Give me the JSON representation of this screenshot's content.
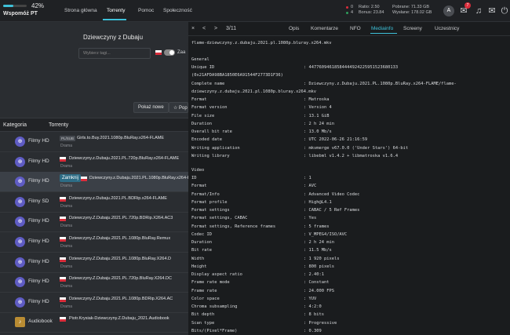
{
  "topbar": {
    "progress_fraction": 0.42,
    "progress_pct": "42%",
    "support_label": "Wspomóż PT",
    "nav": [
      "Strona główna",
      "Torrenty",
      "Pomoc",
      "Społeczność"
    ],
    "active_nav": "Torrenty",
    "stats": {
      "seeding_count": "0",
      "leeching_count": "4",
      "ratio": "Ratio: 2.50",
      "bonus": "Bonus: 23.84",
      "downloaded": "Pobrane: 71.33 GB",
      "uploaded": "Wysłane: 178.02 GB"
    },
    "avatar_letter": "A",
    "notification_badge": "7",
    "accent_color": "#3ec0d8"
  },
  "search": {
    "query": "Dziewczyny z Dubaju",
    "tags_placeholder": "Wybierz tagi...",
    "toggle_label": "Zaa"
  },
  "buttons": {
    "new": "Pokaż nowe",
    "popular": "☆ Popularne"
  },
  "table": {
    "headers": [
      "Kategoria",
      "Torrenty"
    ],
    "rows": [
      {
        "category": "Filmy HD",
        "tag": "PL/SUB",
        "name": "Girls.to.Buy.2021.1080p.BluRay.x264-FLAME",
        "genre": "Drama"
      },
      {
        "category": "Filmy HD",
        "name": "Dziewczyny.z.Dubaju.2021.PL.720p.BluRay.x264-FLAME",
        "genre": "Drama"
      },
      {
        "category": "Filmy HD",
        "close_label": "Zamknij",
        "name": "Dziewczyny.z.Dubaju.2021.PL.1080p.BluRay.x264-FLAME",
        "genre": "Drama"
      },
      {
        "category": "Filmy SD",
        "name": "Dziewczyny.z.Dubaju.2021.PL.BDRip.x264-FLAME",
        "genre": "Drama"
      },
      {
        "category": "Filmy HD",
        "name": "Dziewczyny.Z.Dubaju.2021.PL.720p.BDRip.X264.AC3",
        "genre": "Drama"
      },
      {
        "category": "Filmy HD",
        "name": "Dziewczyny.Z.Dubaju.2021.PL.1080p.BluRay.Remux",
        "genre": "Drama"
      },
      {
        "category": "Filmy HD",
        "name": "Dziewczyny.Z.Dubaju.2021.PL.1080p.BluRay.X264.D",
        "genre": "Drama"
      },
      {
        "category": "Filmy HD",
        "name": "Dziewczyny.Z.Dubaju.2021.PL.720p.BluRay.X264.DC",
        "genre": "Drama"
      },
      {
        "category": "Filmy HD",
        "name": "Dziewczyny.Z.Dubaju.2021.PL.1080p.BDRip.X264.AC",
        "genre": "Drama"
      },
      {
        "category": "Audiobook",
        "name": "Piotr.Krysiak-Dziewczyny.Z.Dubaju_2021.Audiobook",
        "genre": ""
      }
    ]
  },
  "panel": {
    "nav": {
      "close": "×",
      "prev": "<",
      "next": ">",
      "pager": "3/11"
    },
    "tabs": [
      "Opis",
      "Komentarze",
      "NFO",
      "Mediainfo",
      "Screeny",
      "Uczestnicy"
    ],
    "active_tab": "Mediainfo",
    "filename": "flame-dziewczyny.z.dubaju.2021.pl.1080p.bluray.x264.mkv",
    "general_title": "General",
    "general": [
      [
        "Unique ID",
        ": 44776094618584444924225951523680133"
      ],
      [
        "(0x21AFDA98BA1850E6A91544F2773D1F36)",
        ""
      ],
      [
        "Complete name",
        ": Dziewczyny.z.Dubaju.2021.PL.1080p.BluRay.x264-FLAME/flame-"
      ],
      [
        "dziewczyny.z.dubaju.2021.pl.1080p.bluray.x264.mkv",
        ""
      ],
      [
        "Format",
        ": Matroska"
      ],
      [
        "Format version",
        ": Version 4"
      ],
      [
        "File size",
        ": 13.1 GiB"
      ],
      [
        "Duration",
        ": 2 h 24 min"
      ],
      [
        "Overall bit rate",
        ": 13.0 Mb/s"
      ],
      [
        "Encoded date",
        ": UTC 2022-06-26 21:16:59"
      ],
      [
        "Writing application",
        ": mkvmerge v67.0.0 ('Under Stars') 64-bit"
      ],
      [
        "Writing library",
        ": libebml v1.4.2 + libmatroska v1.6.4"
      ]
    ],
    "video_title": "Video",
    "video": [
      [
        "ID",
        ": 1"
      ],
      [
        "Format",
        ": AVC"
      ],
      [
        "Format/Info",
        ": Advanced Video Codec"
      ],
      [
        "Format profile",
        ": High@L4.1"
      ],
      [
        "Format settings",
        ": CABAC / 5 Ref Frames"
      ],
      [
        "Format settings, CABAC",
        ": Yes"
      ],
      [
        "Format settings, Reference frames",
        ": 5 frames"
      ],
      [
        "Codec ID",
        ": V_MPEG4/ISO/AVC"
      ],
      [
        "Duration",
        ": 2 h 24 min"
      ],
      [
        "Bit rate",
        ": 11.5 Mb/s"
      ],
      [
        "Width",
        ": 1 920 pixels"
      ],
      [
        "Height",
        ": 800 pixels"
      ],
      [
        "Display aspect ratio",
        ": 2.40:1"
      ],
      [
        "Frame rate mode",
        ": Constant"
      ],
      [
        "Frame rate",
        ": 24.000 FPS"
      ],
      [
        "Color space",
        ": YUV"
      ],
      [
        "Chroma subsampling",
        ": 4:2:0"
      ],
      [
        "Bit depth",
        ": 8 bits"
      ],
      [
        "Scan type",
        ": Progressive"
      ],
      [
        "Bits/(Pixel*Frame)",
        ": 0.309"
      ]
    ]
  }
}
